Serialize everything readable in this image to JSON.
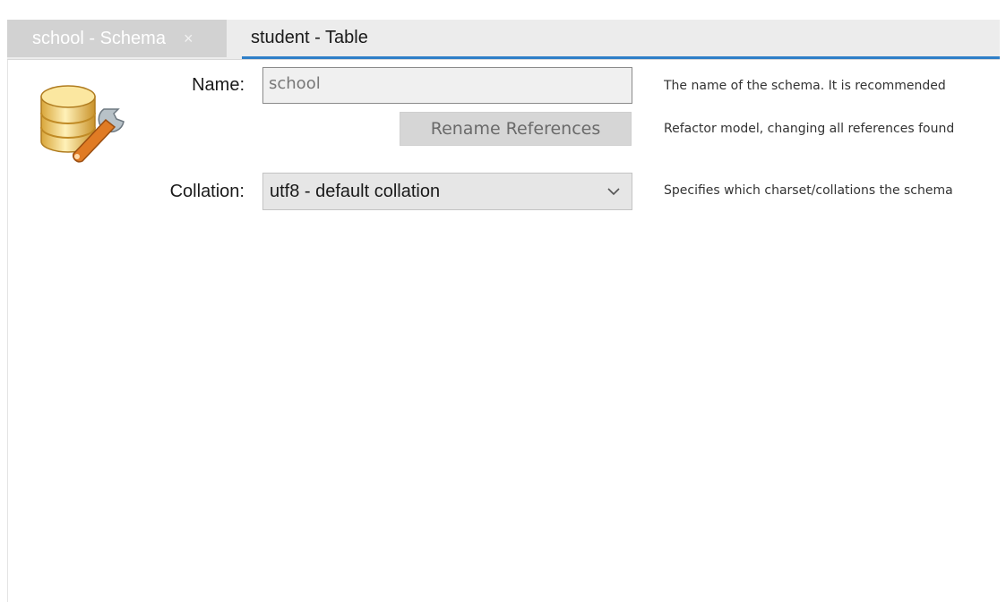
{
  "tabs": [
    {
      "label": "school - Schema",
      "close": "×",
      "active": false
    },
    {
      "label": "student - Table",
      "active": true
    }
  ],
  "form": {
    "name_label": "Name:",
    "name_value": "school",
    "rename_label": "Rename References",
    "collation_label": "Collation:",
    "collation_value": "utf8 - default collation"
  },
  "descriptions": {
    "name": "The name of the schema. It is recommended",
    "rename": "Refactor model, changing all references found",
    "collation": "Specifies which charset/collations the schema"
  },
  "icons": {
    "schema": "database-wrench-icon",
    "dropdown": "chevron-down-icon",
    "close": "close-icon"
  },
  "colors": {
    "accent": "#2f7fc8",
    "inactive_tab": "#d2d2d2"
  }
}
